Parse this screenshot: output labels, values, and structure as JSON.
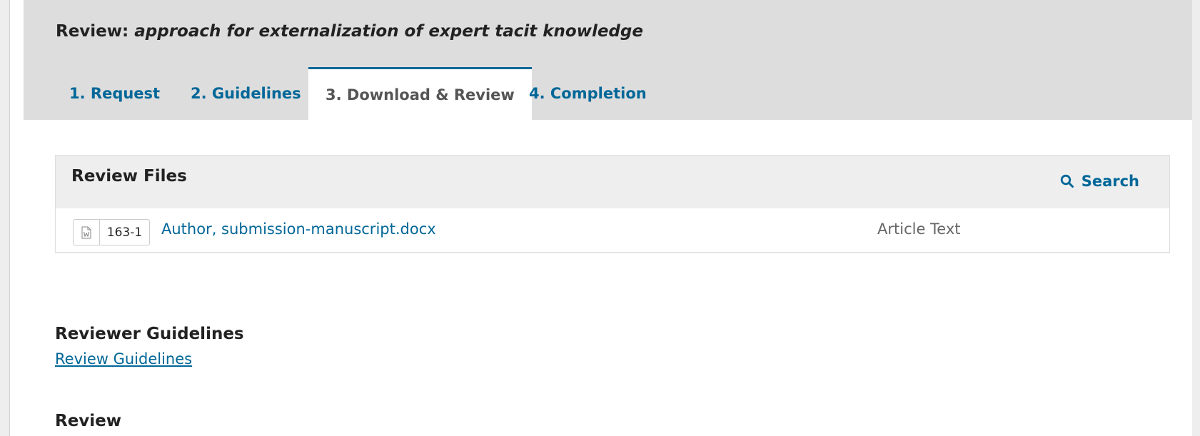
{
  "header": {
    "title_prefix": "Review: ",
    "title_italic": "approach for externalization of expert tacit knowledge"
  },
  "tabs": [
    {
      "label": "1. Request",
      "active": false
    },
    {
      "label": "2. Guidelines",
      "active": false
    },
    {
      "label": "3. Download & Review",
      "active": true
    },
    {
      "label": "4. Completion",
      "active": false
    }
  ],
  "review_files": {
    "title": "Review Files",
    "search_label": "Search",
    "files": [
      {
        "id": "163-1",
        "name": "Author, submission-manuscript.docx",
        "genre": "Article Text",
        "icon": "word-document-icon"
      }
    ]
  },
  "reviewer_guidelines": {
    "heading": "Reviewer Guidelines",
    "link_label": "Review Guidelines"
  },
  "review": {
    "heading": "Review"
  },
  "colors": {
    "accent": "#006798",
    "header_bg": "#dddddd",
    "files_header_bg": "#eeeeee"
  }
}
